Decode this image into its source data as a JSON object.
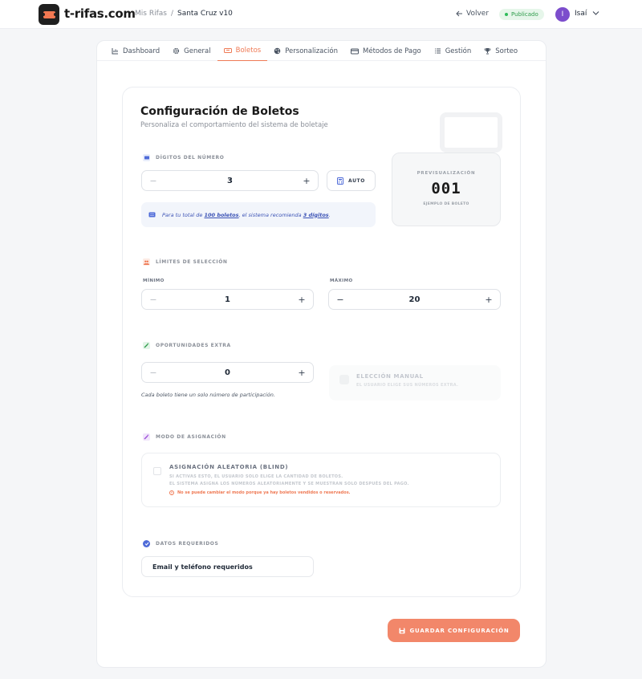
{
  "header": {
    "brand": "t-rifas.com",
    "breadcrumb": [
      "Mis Rifas",
      "/",
      "Santa Cruz v10"
    ],
    "back_label": "Volver",
    "status": "Publicado",
    "avatar_initial": "I",
    "username": "Isaí"
  },
  "tabs": [
    {
      "label": "Dashboard",
      "icon": "chart-icon"
    },
    {
      "label": "General",
      "icon": "gear-icon"
    },
    {
      "label": "Boletos",
      "icon": "ticket-icon",
      "active": true
    },
    {
      "label": "Personalización",
      "icon": "palette-icon"
    },
    {
      "label": "Métodos de Pago",
      "icon": "card-icon"
    },
    {
      "label": "Gestión",
      "icon": "list-icon"
    },
    {
      "label": "Sorteo",
      "icon": "trophy-icon"
    }
  ],
  "page": {
    "title": "Configuración de Boletos",
    "subtitle": "Personaliza el comportamiento del sistema de boletaje"
  },
  "digits": {
    "label": "Dígitos del número",
    "value": "3",
    "minus": "−",
    "plus": "+",
    "auto_label": "AUTO",
    "info_prefix": "Para tu total de ",
    "info_total": "100 boletos",
    "info_mid": ", el sistema recomienda ",
    "info_digits": "3 dígitos",
    "info_suffix": "."
  },
  "preview": {
    "label": "PREVISUALIZACIÓN",
    "value": "001",
    "caption": "EJEMPLO DE BOLETO"
  },
  "limits": {
    "label": "Límites de selección",
    "min_label": "MÍNIMO",
    "min_value": "1",
    "max_label": "MÁXIMO",
    "max_value": "20"
  },
  "extra": {
    "label": "Oportunidades extra",
    "value": "0",
    "note": "Cada boleto tiene un solo número de participación.",
    "manual_title": "ELECCIÓN MANUAL",
    "manual_sub": "EL USUARIO ELIGE SUS NÚMEROS EXTRA."
  },
  "assignment": {
    "label": "Modo de asignación",
    "option_title": "ASIGNACIÓN ALEATORIA (BLIND)",
    "option_line1": "SI ACTIVAS ESTO, EL USUARIO SOLO ELIGE LA CANTIDAD DE BOLETOS.",
    "option_line2": "EL SISTEMA ASIGNA LOS NÚMEROS ALEATORIAMENTE Y SE MUESTRAN SOLO DESPUÉS DEL PAGO.",
    "warning": "No se puede cambiar el modo porque ya hay boletos vendidos o reservados."
  },
  "required": {
    "label": "Datos requeridos",
    "value": "Email y teléfono requeridos"
  },
  "save_label": "GUARDAR CONFIGURACIÓN",
  "colors": {
    "accent": "#ef7a55",
    "status_green": "#2e9c4b",
    "avatar": "#7c4dcc",
    "info_blue": "#3b52b5"
  }
}
